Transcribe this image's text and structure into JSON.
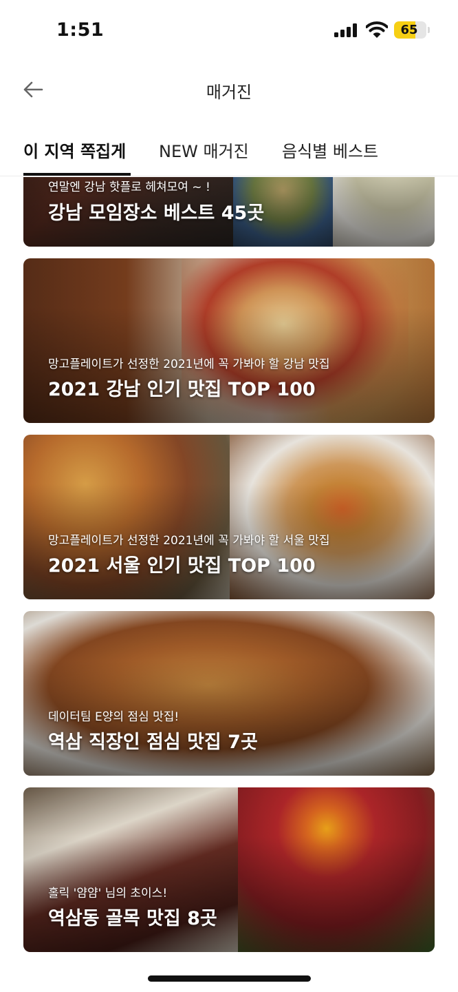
{
  "status_bar": {
    "time": "1:51",
    "battery_level": "65",
    "battery_fraction": 0.65,
    "battery_color": "#f6cf14"
  },
  "header": {
    "back_icon": "arrow-left-icon",
    "title": "매거진"
  },
  "tabs": [
    {
      "label": "이 지역 쪽집게",
      "active": true
    },
    {
      "label": "NEW 매거진",
      "active": false
    },
    {
      "label": "음식별 베스트",
      "active": false
    }
  ],
  "cards": [
    {
      "subtitle": "연말엔 강남 핫플로 헤쳐모여 ~ !",
      "title": "강남 모임장소 베스트 45곳"
    },
    {
      "subtitle": "망고플레이트가 선정한 2021년에 꼭 가봐야 할 강남 맛집",
      "title": "2021 강남 인기 맛집 TOP 100"
    },
    {
      "subtitle": "망고플레이트가 선정한 2021년에 꼭 가봐야 할 서울 맛집",
      "title": "2021 서울 인기 맛집 TOP 100"
    },
    {
      "subtitle": "데이터팀 E양의 점심 맛집!",
      "title": "역삼 직장인 점심 맛집 7곳"
    },
    {
      "subtitle": "홀릭 '얌얌' 님의 초이스!",
      "title": "역삼동 골목 맛집 8곳"
    }
  ]
}
